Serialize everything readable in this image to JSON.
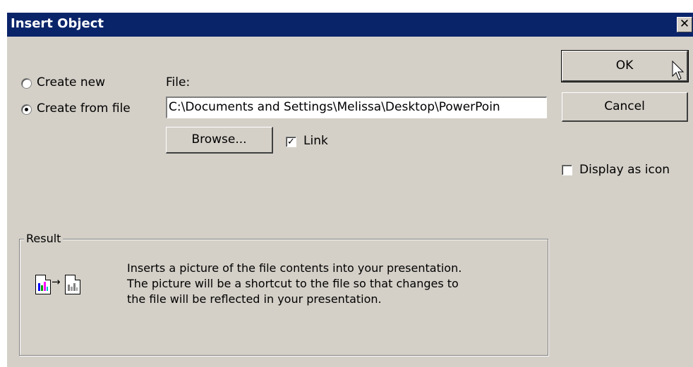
{
  "window": {
    "title": "Insert Object",
    "close_glyph": "✕"
  },
  "options": {
    "create_new_label": "Create new",
    "create_from_file_label": "Create from file",
    "selected": "create_from_file"
  },
  "file": {
    "label": "File:",
    "value": "C:\\Documents and Settings\\Melissa\\Desktop\\PowerPoin",
    "browse_label": "Browse...",
    "link_label": "Link",
    "link_checked": true
  },
  "buttons": {
    "ok_label": "OK",
    "cancel_label": "Cancel"
  },
  "display_as_icon": {
    "label": "Display as icon",
    "checked": false
  },
  "result": {
    "legend": "Result",
    "line1": "Inserts a picture of the file contents into your presentation.",
    "line2": "The picture will be a shortcut to the file so that changes to",
    "line3": "the file will be reflected in your presentation.",
    "arrow": "→"
  },
  "colors": {
    "title_bar": "#0a246a",
    "dialog_bg": "#d4d0c8"
  }
}
